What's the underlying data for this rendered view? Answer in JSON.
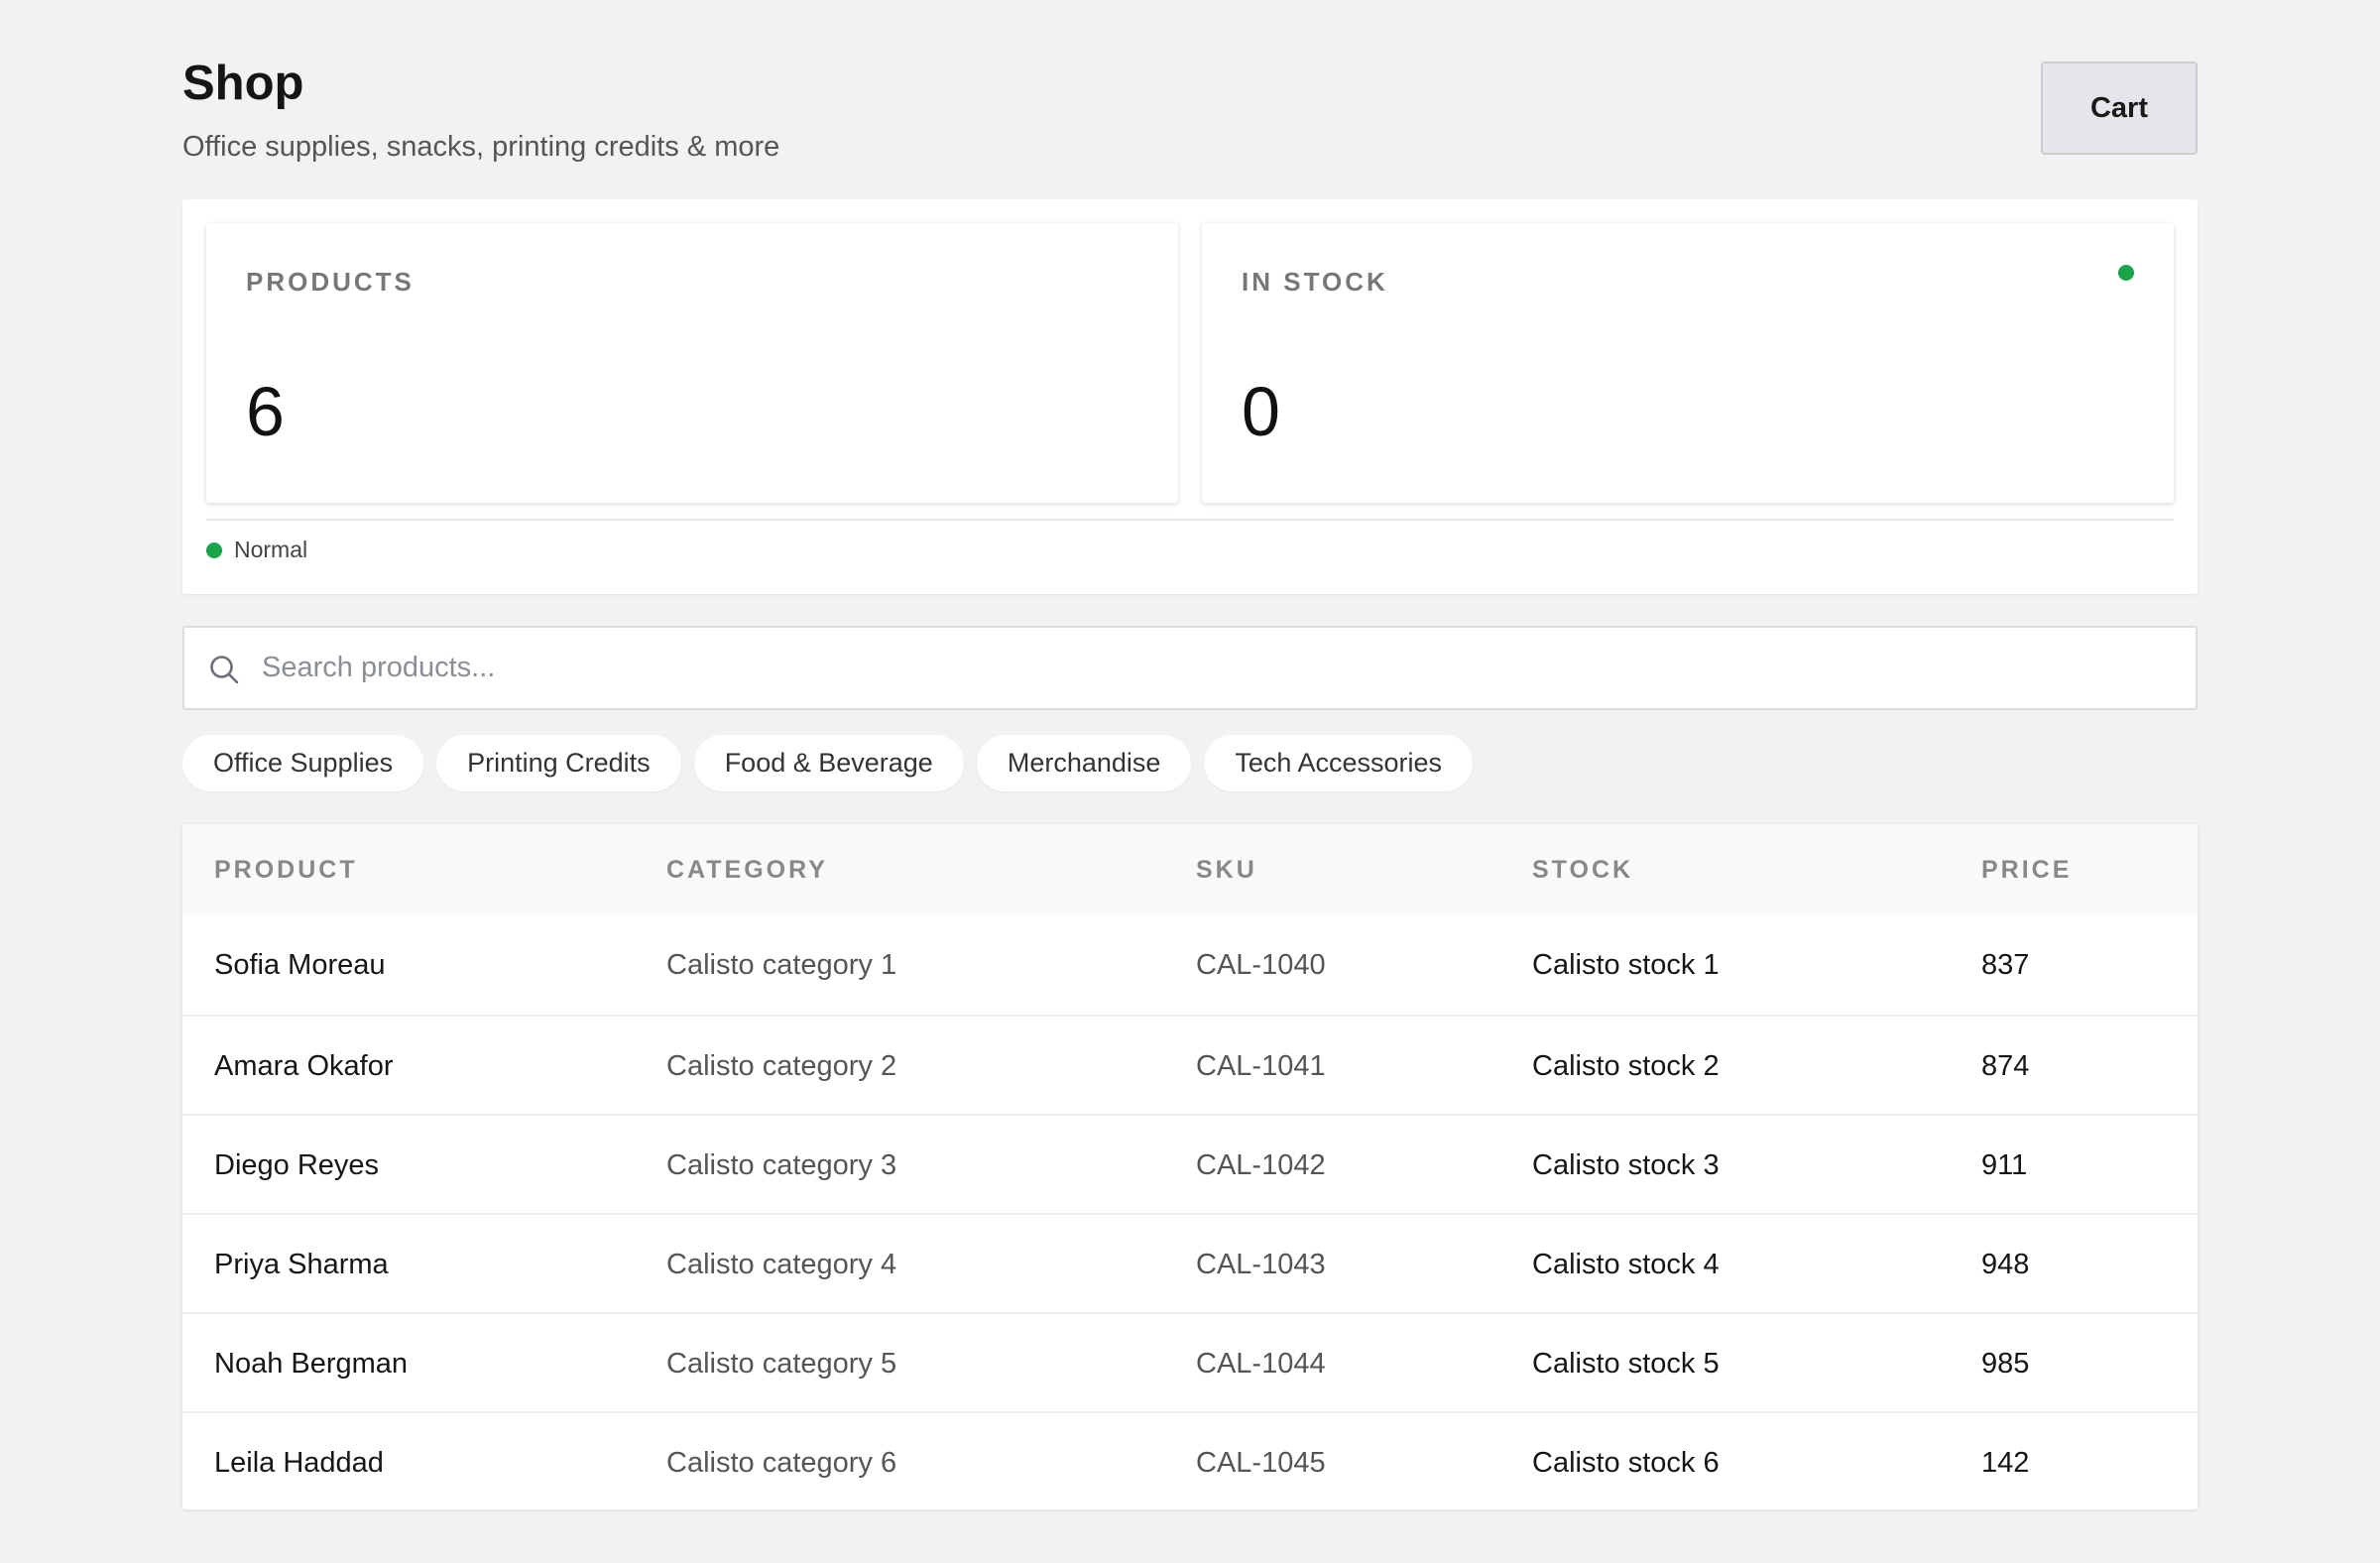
{
  "header": {
    "title": "Shop",
    "subtitle": "Office supplies, snacks, printing credits & more",
    "cart_label": "Cart"
  },
  "stats": {
    "products": {
      "label": "PRODUCTS",
      "value": "6"
    },
    "in_stock": {
      "label": "IN STOCK",
      "value": "0",
      "indicator_color": "#1aa34a"
    },
    "status": {
      "text": "Normal",
      "color": "#1aa34a"
    }
  },
  "search": {
    "placeholder": "Search products...",
    "value": ""
  },
  "categories": [
    "Office Supplies",
    "Printing Credits",
    "Food & Beverage",
    "Merchandise",
    "Tech Accessories"
  ],
  "table": {
    "columns": [
      "PRODUCT",
      "CATEGORY",
      "SKU",
      "STOCK",
      "PRICE"
    ],
    "rows": [
      {
        "product": "Sofia Moreau",
        "category": "Calisto category 1",
        "sku": "CAL-1040",
        "stock": "Calisto stock 1",
        "price": "837"
      },
      {
        "product": "Amara Okafor",
        "category": "Calisto category 2",
        "sku": "CAL-1041",
        "stock": "Calisto stock 2",
        "price": "874"
      },
      {
        "product": "Diego Reyes",
        "category": "Calisto category 3",
        "sku": "CAL-1042",
        "stock": "Calisto stock 3",
        "price": "911"
      },
      {
        "product": "Priya Sharma",
        "category": "Calisto category 4",
        "sku": "CAL-1043",
        "stock": "Calisto stock 4",
        "price": "948"
      },
      {
        "product": "Noah Bergman",
        "category": "Calisto category 5",
        "sku": "CAL-1044",
        "stock": "Calisto stock 5",
        "price": "985"
      },
      {
        "product": "Leila Haddad",
        "category": "Calisto category 6",
        "sku": "CAL-1045",
        "stock": "Calisto stock 6",
        "price": "142"
      }
    ]
  },
  "icons": {
    "search": "search-icon"
  }
}
